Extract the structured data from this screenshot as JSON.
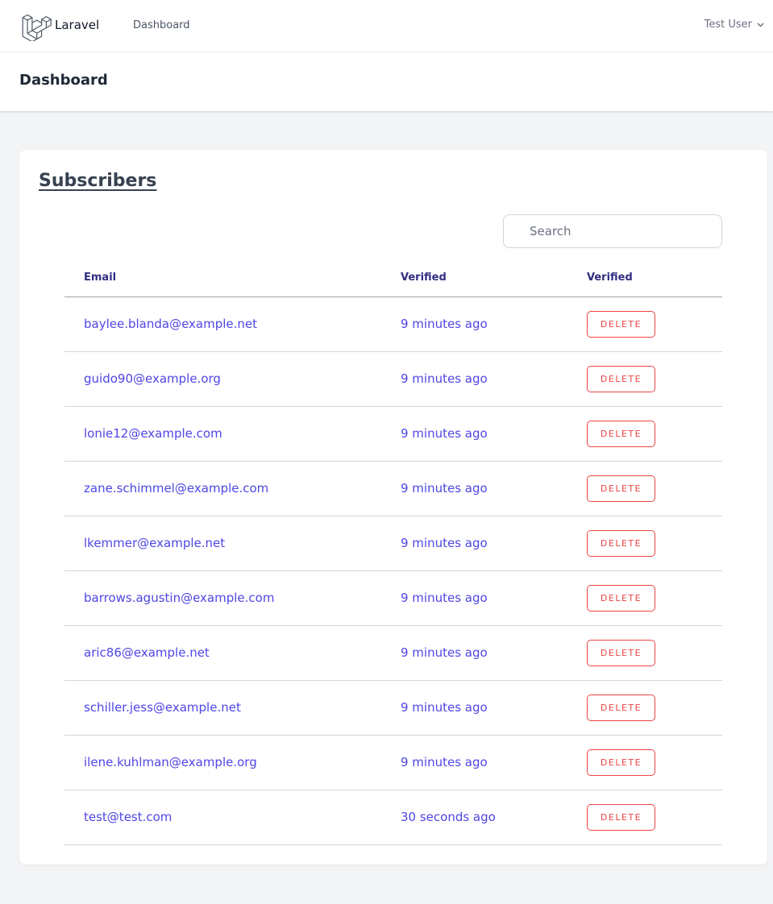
{
  "nav": {
    "brand": "Laravel",
    "dashboard_link": "Dashboard",
    "user": "Test User"
  },
  "header": {
    "title": "Dashboard"
  },
  "subscribers": {
    "title": "Subscribers",
    "search_placeholder": "Search",
    "columns": [
      "Email",
      "Verified",
      "Verified"
    ],
    "delete_label": "DELETE",
    "rows": [
      {
        "email": "baylee.blanda@example.net",
        "verified": "9 minutes ago"
      },
      {
        "email": "guido90@example.org",
        "verified": "9 minutes ago"
      },
      {
        "email": "lonie12@example.com",
        "verified": "9 minutes ago"
      },
      {
        "email": "zane.schimmel@example.com",
        "verified": "9 minutes ago"
      },
      {
        "email": "lkemmer@example.net",
        "verified": "9 minutes ago"
      },
      {
        "email": "barrows.agustin@example.com",
        "verified": "9 minutes ago"
      },
      {
        "email": "aric86@example.net",
        "verified": "9 minutes ago"
      },
      {
        "email": "schiller.jess@example.net",
        "verified": "9 minutes ago"
      },
      {
        "email": "ilene.kuhlman@example.org",
        "verified": "9 minutes ago"
      },
      {
        "email": "test@test.com",
        "verified": "30 seconds ago"
      }
    ]
  },
  "colors": {
    "accent": "#4f46e5",
    "danger": "#ef4444",
    "header_text": "#312e81",
    "background": "#f3f4f6"
  }
}
